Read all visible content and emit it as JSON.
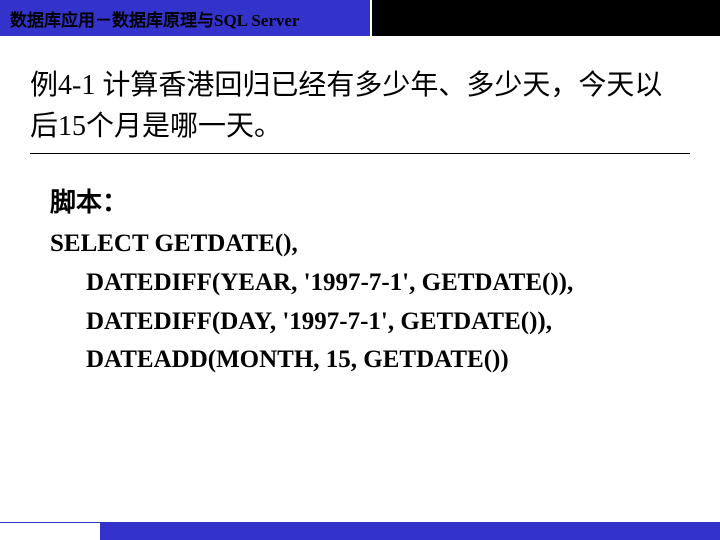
{
  "header": {
    "title": "数据库应用－数据库原理与SQL Server"
  },
  "example": {
    "heading": "例4-1  计算香港回归已经有多少年、多少天，今天以后15个月是哪一天。"
  },
  "script": {
    "label": "脚本：",
    "lines": [
      "SELECT GETDATE(),",
      "DATEDIFF(YEAR, '1997-7-1', GETDATE()),",
      "DATEDIFF(DAY, '1997-7-1', GETDATE()),",
      "DATEADD(MONTH, 15, GETDATE())"
    ]
  }
}
